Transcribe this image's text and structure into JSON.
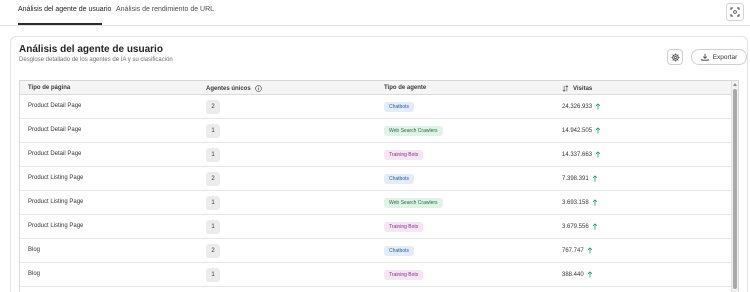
{
  "tabs": [
    {
      "label": "Análisis del agente de usuario",
      "active": true
    },
    {
      "label": "Análisis de rendimiento de URL",
      "active": false
    }
  ],
  "card": {
    "title": "Análisis del agente de usuario",
    "subtitle": "Desglose detallado de los agentes de IA y su clasificación",
    "export_label": "Exportar"
  },
  "table": {
    "headers": {
      "page_type": "Tipo de página",
      "unique_agents": "Agentes únicos",
      "agent_type": "Tipo de agente",
      "visits": "Visitas"
    },
    "rows": [
      {
        "page_type": "Product Detail Page",
        "unique_agents": "2",
        "agent_type": "Chatbots",
        "visits": "24.326.933"
      },
      {
        "page_type": "Product Detail Page",
        "unique_agents": "1",
        "agent_type": "Web Search Crawlers",
        "visits": "14.942.505"
      },
      {
        "page_type": "Product Detail Page",
        "unique_agents": "1",
        "agent_type": "Training Bots",
        "visits": "14.337.663"
      },
      {
        "page_type": "Product Listing Page",
        "unique_agents": "2",
        "agent_type": "Chatbots",
        "visits": "7.398.391"
      },
      {
        "page_type": "Product Listing Page",
        "unique_agents": "1",
        "agent_type": "Web Search Crawlers",
        "visits": "3.693.158"
      },
      {
        "page_type": "Product Listing Page",
        "unique_agents": "1",
        "agent_type": "Training Bots",
        "visits": "3.679.556"
      },
      {
        "page_type": "Blog",
        "unique_agents": "2",
        "agent_type": "Chatbots",
        "visits": "767.747"
      },
      {
        "page_type": "Blog",
        "unique_agents": "1",
        "agent_type": "Training Bots",
        "visits": "388.440"
      }
    ]
  },
  "colors": {
    "chatbots_bg": "#e3edf9",
    "chatbots_text": "#2b5a91",
    "crawlers_bg": "#dff3e7",
    "crawlers_text": "#1e6b44",
    "training_bg": "#f6e6f5",
    "training_text": "#7b3578",
    "trend_up": "#1a9a62"
  },
  "icons": {
    "fullscreen": "fullscreen-icon",
    "settings": "gear-icon",
    "export": "download-icon",
    "info": "info-icon",
    "sort": "sort-icon",
    "trend": "arrow-up-icon"
  }
}
